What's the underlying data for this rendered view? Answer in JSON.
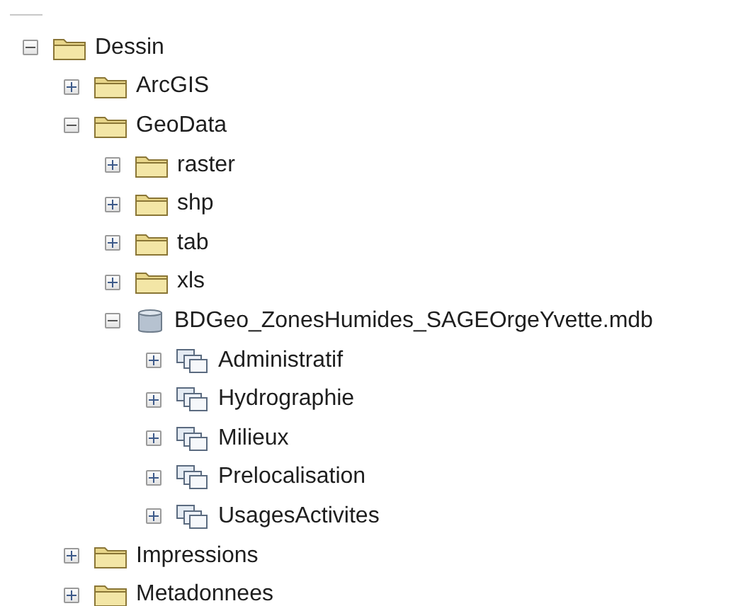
{
  "tree": [
    {
      "label": "Dessin",
      "kind": "folder",
      "expanded": true,
      "children": [
        {
          "label": "ArcGIS",
          "kind": "folder",
          "expanded": false
        },
        {
          "label": "GeoData",
          "kind": "folder",
          "expanded": true,
          "children": [
            {
              "label": "raster",
              "kind": "folder",
              "expanded": false
            },
            {
              "label": "shp",
              "kind": "folder",
              "expanded": false
            },
            {
              "label": "tab",
              "kind": "folder",
              "expanded": false
            },
            {
              "label": "xls",
              "kind": "folder",
              "expanded": false
            },
            {
              "label": "BDGeo_ZonesHumides_SAGEOrgeYvette.mdb",
              "kind": "database",
              "expanded": true,
              "children": [
                {
                  "label": "Administratif",
                  "kind": "dataset",
                  "expanded": false
                },
                {
                  "label": "Hydrographie",
                  "kind": "dataset",
                  "expanded": false
                },
                {
                  "label": "Milieux",
                  "kind": "dataset",
                  "expanded": false
                },
                {
                  "label": "Prelocalisation",
                  "kind": "dataset",
                  "expanded": false
                },
                {
                  "label": "UsagesActivites",
                  "kind": "dataset",
                  "expanded": false
                }
              ]
            }
          ]
        },
        {
          "label": "Impressions",
          "kind": "folder",
          "expanded": false
        },
        {
          "label": "Metadonnees",
          "kind": "folder",
          "expanded": false
        }
      ]
    }
  ]
}
